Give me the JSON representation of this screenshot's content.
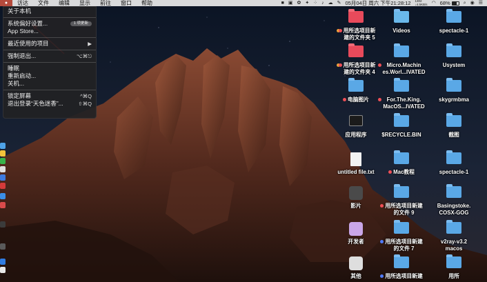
{
  "menubar": {
    "apple_icon": "apple-logo-icon",
    "items": [
      "访达",
      "文件",
      "编辑",
      "显示",
      "前往",
      "窗口",
      "帮助"
    ],
    "status_icons": [
      "app-icon-1",
      "app-icon-2",
      "paw-icon",
      "bird-icon",
      "dots-icon",
      "bell-icon",
      "cloud-icon",
      "wrench-icon"
    ],
    "clock": "05月04日 周六 下午21:28:12",
    "net_upload": "1302",
    "net_download": "↓4.5KB/s",
    "wifi_icon": "wifi-icon",
    "battery_percent": "68%",
    "battery_level": 0.68
  },
  "apple_menu": {
    "about": "关于本机",
    "sysprefs": "系统偏好设置...",
    "sysprefs_badge": "1 项更新",
    "appstore": "App Store...",
    "recent": "最近使用的项目",
    "recent_arrow": "▶",
    "forcequit": "强制退出...",
    "forcequit_shortcut": "⌥⌘⎋",
    "sleep": "睡眠",
    "restart": "重新启动...",
    "shutdown": "关机...",
    "lock": "锁定屏幕",
    "lock_shortcut": "^⌘Q",
    "logout": "退出登录“天色迷香”...",
    "logout_shortcut": "⇧⌘Q"
  },
  "desktop": {
    "col1": [
      {
        "label1": "用所选项目新",
        "label2": "建的文件夹 5",
        "tag": "red-orange"
      },
      {
        "label1": "用所选项目新",
        "label2": "建的文件夹 4",
        "tag": "red-orange"
      },
      {
        "label1": "电脑图片",
        "label2": "",
        "tag": "red"
      },
      {
        "label1": "应用程序",
        "label2": "",
        "tag": ""
      },
      {
        "label1": "untitled file.txt",
        "label2": "",
        "tag": ""
      },
      {
        "label1": "影片",
        "label2": "",
        "tag": ""
      },
      {
        "label1": "开发者",
        "label2": "",
        "tag": ""
      },
      {
        "label1": "其他",
        "label2": "",
        "tag": ""
      }
    ],
    "col2": [
      {
        "label1": "Videos",
        "label2": "",
        "tag": ""
      },
      {
        "label1": "Micro.Machin",
        "label2": "es.Worl...IVATED",
        "tag": "red"
      },
      {
        "label1": "For.The.King.",
        "label2": "MacOS...IVATED",
        "tag": "red"
      },
      {
        "label1": "$RECYCLE.BIN",
        "label2": "",
        "tag": ""
      },
      {
        "label1": "Mac教程",
        "label2": "",
        "tag": "red"
      },
      {
        "label1": "用所选项目新建",
        "label2": "的文件 9",
        "tag": "red"
      },
      {
        "label1": "用所选项目新建",
        "label2": "的文件 7",
        "tag": "blue"
      },
      {
        "label1": "用所选项目新建",
        "label2": "",
        "tag": "blue"
      }
    ],
    "col3": [
      {
        "label1": "spectacle-1",
        "label2": ""
      },
      {
        "label1": "Usystem",
        "label2": ""
      },
      {
        "label1": "skygrmbma",
        "label2": ""
      },
      {
        "label1": "截图",
        "label2": ""
      },
      {
        "label1": "spectacle-1",
        "label2": ""
      },
      {
        "label1": "Basingstoke.",
        "label2": "COSX-GOG"
      },
      {
        "label1": "v2ray-v3.2",
        "label2": "macos"
      },
      {
        "label1": "用所",
        "label2": ""
      }
    ]
  }
}
